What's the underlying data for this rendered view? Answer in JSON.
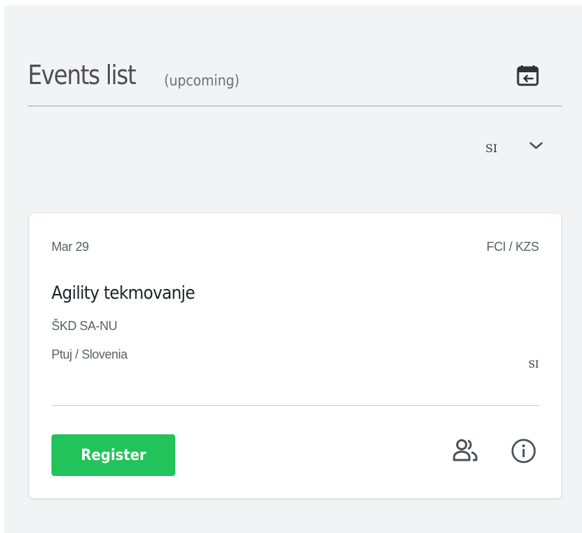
{
  "header": {
    "title": "Events list",
    "subtitle": "(upcoming)",
    "calendar_icon": "calendar-back-icon"
  },
  "language_filter": {
    "selected": "SI",
    "icon": "chevron-down-icon"
  },
  "events": [
    {
      "date": "Mar 29",
      "organization": "FCI / KZS",
      "title": "Agility tekmovanje",
      "club": "ŠKD SA-NU",
      "location": "Ptuj / Slovenia",
      "language": "SI",
      "register_label": "Register",
      "participants_icon": "participants-icon",
      "info_icon": "info-icon"
    }
  ],
  "colors": {
    "accent_green": "#22c35a",
    "background": "#f2f3f5",
    "card": "#ffffff",
    "title_text": "#4a4f58"
  }
}
